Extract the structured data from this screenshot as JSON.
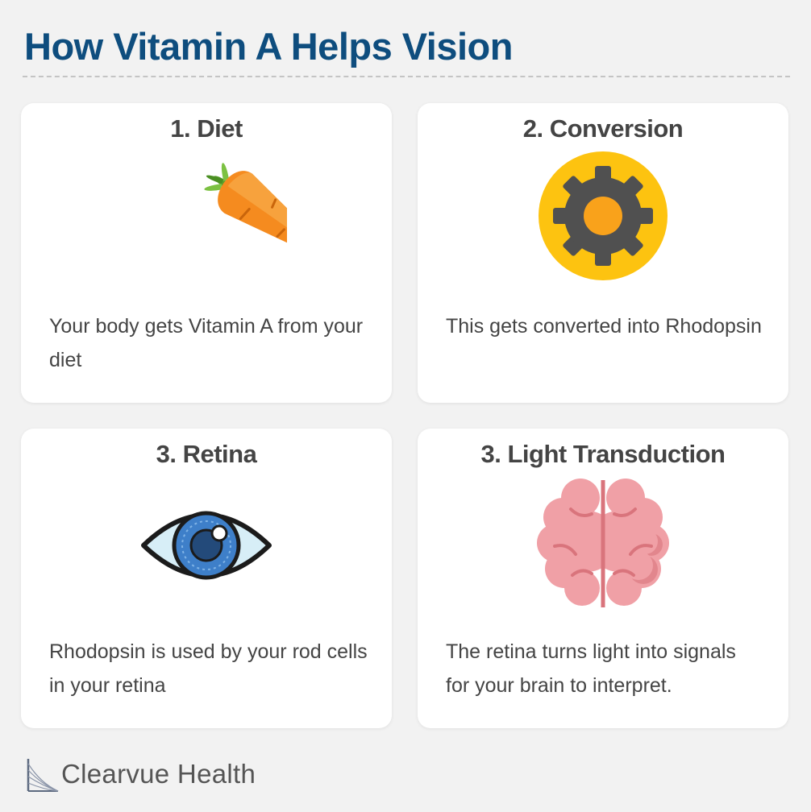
{
  "title": "How Vitamin A Helps Vision",
  "steps": [
    {
      "title": "1. Diet",
      "icon": "carrot-icon",
      "text": "Your body gets Vitamin A from your diet"
    },
    {
      "title": "2. Conversion",
      "icon": "gear-icon",
      "text": "This gets converted into Rhodopsin"
    },
    {
      "title": "3. Retina",
      "icon": "eye-icon",
      "text": "Rhodopsin is used by your rod cells in your retina"
    },
    {
      "title": "3. Light Transduction",
      "icon": "brain-icon",
      "text": "The retina turns light into signals for your brain to interpret."
    }
  ],
  "brand": {
    "name": "Clearvue Health",
    "logo_icon": "clearvue-logo-icon"
  },
  "colors": {
    "title": "#0e4d7e",
    "text": "#444444",
    "background": "#f2f2f2",
    "card": "#ffffff",
    "carrot": "#f58b1f",
    "gear_circle": "#fdc310",
    "gear": "#505050",
    "eye_iris": "#3e7fc9",
    "brain": "#f0a0a6"
  }
}
